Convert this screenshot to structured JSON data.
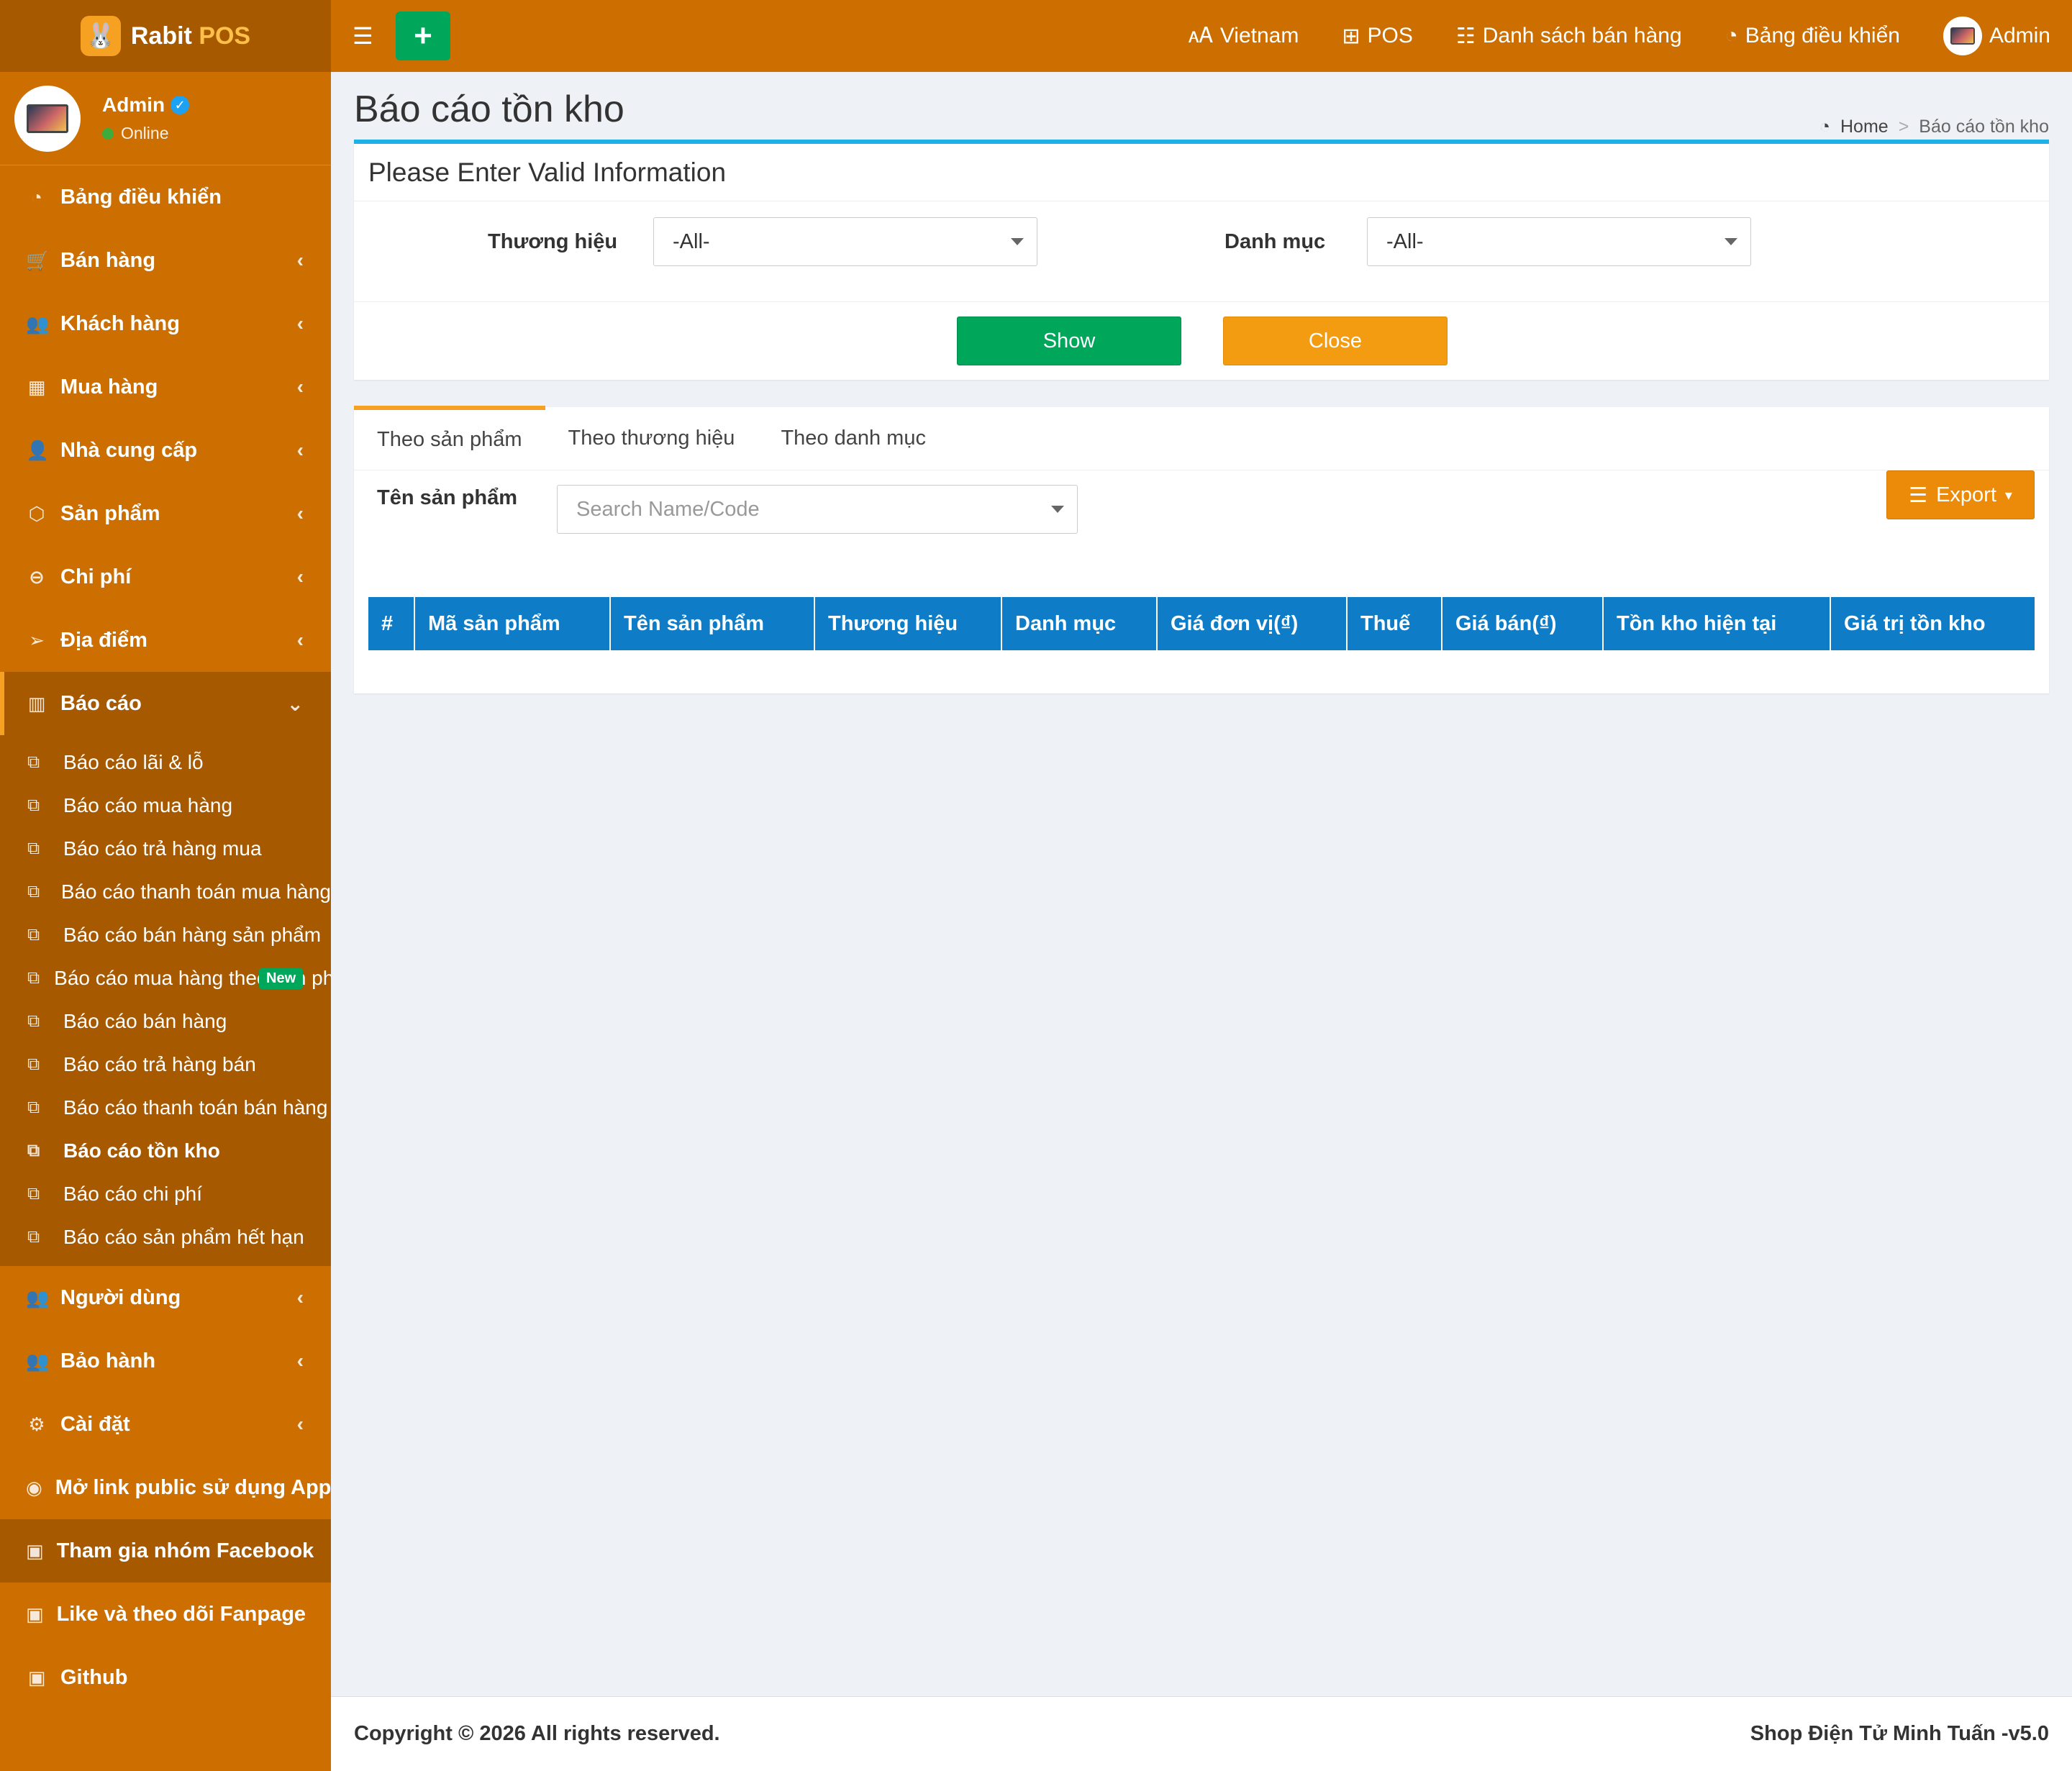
{
  "brand": {
    "name": "Rabit",
    "accent": "POS",
    "color_main": "#cc6f00",
    "color_dark": "#a75900"
  },
  "user": {
    "name": "Admin",
    "status": "Online"
  },
  "topbar": {
    "language": "Vietnam",
    "pos": "POS",
    "sales_list": "Danh sách bán hàng",
    "dashboard": "Bảng điều khiển",
    "account": "Admin"
  },
  "sidebar": {
    "items": [
      {
        "label": "Bảng điều khiển",
        "icon": "dashboard-icon"
      },
      {
        "label": "Bán hàng",
        "icon": "cart-icon"
      },
      {
        "label": "Khách hàng",
        "icon": "users-icon"
      },
      {
        "label": "Mua hàng",
        "icon": "grid-icon"
      },
      {
        "label": "Nhà cung cấp",
        "icon": "user-plus-icon"
      },
      {
        "label": "Sản phẩm",
        "icon": "boxes-icon"
      },
      {
        "label": "Chi phí",
        "icon": "minus-circle-icon"
      },
      {
        "label": "Địa điểm",
        "icon": "location-arrow-icon"
      },
      {
        "label": "Báo cáo",
        "icon": "bar-chart-icon"
      }
    ],
    "report_sub": [
      "Báo cáo lãi & lỗ",
      "Báo cáo mua hàng",
      "Báo cáo trả hàng mua",
      "Báo cáo thanh toán mua hàng",
      "Báo cáo bán hàng sản phẩm",
      "Báo cáo mua hàng theo sản phẩm",
      "Báo cáo bán hàng",
      "Báo cáo trả hàng bán",
      "Báo cáo thanh toán bán hàng",
      "Báo cáo tồn kho",
      "Báo cáo chi phí",
      "Báo cáo sản phẩm hết hạn"
    ],
    "new_badge": "New",
    "bottom_items": [
      {
        "label": "Người dùng",
        "icon": "users-icon"
      },
      {
        "label": "Bảo hành",
        "icon": "users-icon"
      },
      {
        "label": "Cài đặt",
        "icon": "cogs-icon"
      },
      {
        "label": "Mở link public sử dụng App",
        "icon": "globe-icon"
      },
      {
        "label": "Tham gia nhóm Facebook",
        "icon": "briefcase-icon"
      },
      {
        "label": "Like và theo dõi Fanpage",
        "icon": "briefcase-icon"
      },
      {
        "label": "Github",
        "icon": "briefcase-icon"
      }
    ]
  },
  "page": {
    "title": "Báo cáo tồn kho",
    "breadcrumb_home": "Home",
    "breadcrumb_sep": ">",
    "breadcrumb_current": "Báo cáo tồn kho"
  },
  "filter": {
    "heading": "Please Enter Valid Information",
    "brand_label": "Thương hiệu",
    "brand_value": "-All-",
    "category_label": "Danh mục",
    "category_value": "-All-",
    "show_label": "Show",
    "close_label": "Close"
  },
  "tabs": [
    "Theo sản phẩm",
    "Theo thương hiệu",
    "Theo danh mục"
  ],
  "product_search": {
    "label": "Tên sản phẩm",
    "placeholder": "Search Name/Code"
  },
  "export_label": "Export",
  "table": {
    "columns": [
      "#",
      "Mã sản phẩm",
      "Tên sản phẩm",
      "Thương hiệu",
      "Danh mục",
      "Giá đơn vị(₫)",
      "Thuế",
      "Giá bán(₫)",
      "Tồn kho hiện tại",
      "Giá trị tồn kho"
    ]
  },
  "footer": {
    "copyright": "Copyright © 2026 All rights reserved.",
    "shop": "Shop Điện Tử Minh Tuấn -v5.0"
  }
}
